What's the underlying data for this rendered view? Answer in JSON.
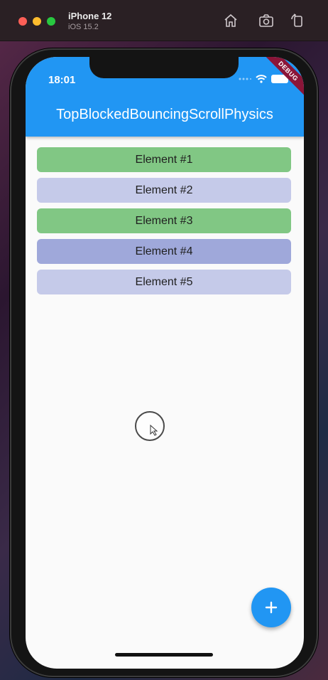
{
  "simulator": {
    "device_name": "iPhone 12",
    "os_version": "iOS 15.2"
  },
  "status_bar": {
    "time": "18:01"
  },
  "debug_banner": "DEBUG",
  "app_bar": {
    "title": "TopBlockedBouncingScrollPhysics",
    "color": "#2196f3"
  },
  "list": {
    "items": [
      {
        "label": "Element #1",
        "color": "#81c784"
      },
      {
        "label": "Element #2",
        "color": "#c5cae9"
      },
      {
        "label": "Element #3",
        "color": "#81c784"
      },
      {
        "label": "Element #4",
        "color": "#9fa8da"
      },
      {
        "label": "Element #5",
        "color": "#c5cae9"
      }
    ]
  },
  "fab": {
    "icon": "plus-icon",
    "color": "#2196f3"
  },
  "icons": {
    "home": "home-icon",
    "screenshot": "camera-icon",
    "rotate": "rotate-icon",
    "wifi": "wifi-icon",
    "battery": "battery-icon"
  }
}
